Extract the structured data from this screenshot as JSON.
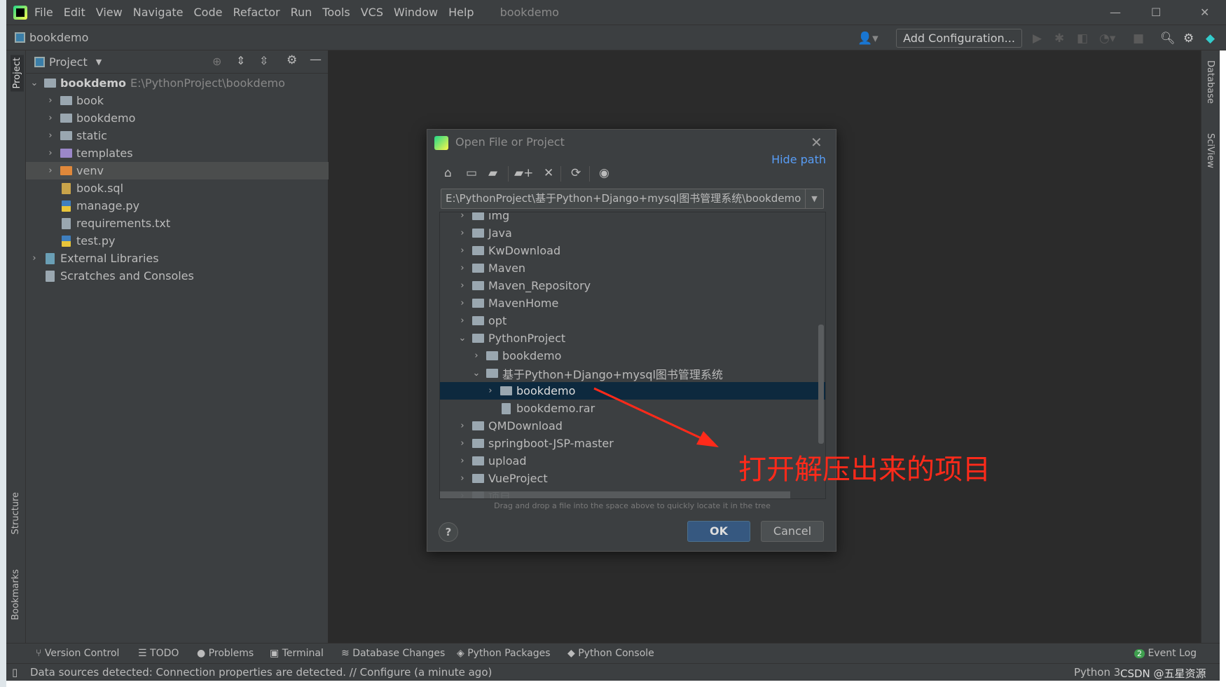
{
  "menubar": {
    "items": [
      "File",
      "Edit",
      "View",
      "Navigate",
      "Code",
      "Refactor",
      "Run",
      "Tools",
      "VCS",
      "Window",
      "Help"
    ],
    "window_title": "bookdemo"
  },
  "navbar": {
    "project": "bookdemo",
    "add_configuration": "Add Configuration..."
  },
  "left_stripe": {
    "project": "Project",
    "structure": "Structure",
    "bookmarks": "Bookmarks"
  },
  "right_stripe": {
    "database": "Database",
    "sciview": "SciView"
  },
  "project_panel": {
    "title": "Project",
    "root": {
      "name": "bookdemo",
      "path": "E:\\PythonProject\\bookdemo"
    },
    "items": [
      {
        "name": "book",
        "type": "folder",
        "indent": 1,
        "expandable": true
      },
      {
        "name": "bookdemo",
        "type": "folder",
        "indent": 1,
        "expandable": true
      },
      {
        "name": "static",
        "type": "folder",
        "indent": 1,
        "expandable": true
      },
      {
        "name": "templates",
        "type": "folder-purple",
        "indent": 1,
        "expandable": true
      },
      {
        "name": "venv",
        "type": "folder-orange",
        "indent": 1,
        "expandable": true,
        "selected": true
      },
      {
        "name": "book.sql",
        "type": "sql",
        "indent": 1
      },
      {
        "name": "manage.py",
        "type": "python",
        "indent": 1
      },
      {
        "name": "requirements.txt",
        "type": "text",
        "indent": 1
      },
      {
        "name": "test.py",
        "type": "python",
        "indent": 1
      },
      {
        "name": "External Libraries",
        "type": "library",
        "indent": 0,
        "expandable": true
      },
      {
        "name": "Scratches and Consoles",
        "type": "scratch",
        "indent": 0
      }
    ]
  },
  "dialog": {
    "title": "Open File or Project",
    "hide_path": "Hide path",
    "path": "E:\\PythonProject\\基于Python+Django+mysql图书管理系统\\bookdemo",
    "tree": [
      {
        "name": "img",
        "indent": 0,
        "expanded": false
      },
      {
        "name": "Java",
        "indent": 0,
        "expanded": false
      },
      {
        "name": "KwDownload",
        "indent": 0,
        "expanded": false
      },
      {
        "name": "Maven",
        "indent": 0,
        "expanded": false
      },
      {
        "name": "Maven_Repository",
        "indent": 0,
        "expanded": false
      },
      {
        "name": "MavenHome",
        "indent": 0,
        "expanded": false
      },
      {
        "name": "opt",
        "indent": 0,
        "expanded": false
      },
      {
        "name": "PythonProject",
        "indent": 0,
        "expanded": true
      },
      {
        "name": "bookdemo",
        "indent": 1,
        "expanded": false
      },
      {
        "name": "基于Python+Django+mysql图书管理系统",
        "indent": 1,
        "expanded": true
      },
      {
        "name": "bookdemo",
        "indent": 2,
        "expanded": false,
        "selected": true
      },
      {
        "name": "bookdemo.rar",
        "indent": 2,
        "file": true
      },
      {
        "name": "QMDownload",
        "indent": 0,
        "expanded": false
      },
      {
        "name": "springboot-JSP-master",
        "indent": 0,
        "expanded": false
      },
      {
        "name": "upload",
        "indent": 0,
        "expanded": false
      },
      {
        "name": "VueProject",
        "indent": 0,
        "expanded": false
      },
      {
        "name": "项目",
        "indent": 0,
        "expanded": false
      }
    ],
    "hint": "Drag and drop a file into the space above to quickly locate it in the tree",
    "ok": "OK",
    "cancel": "Cancel",
    "help": "?"
  },
  "annotation": {
    "text": "打开解压出来的项目",
    "color": "#ff2a1a"
  },
  "bottom_tools": [
    "Version Control",
    "TODO",
    "Problems",
    "Terminal",
    "Database Changes",
    "Python Packages",
    "Python Console"
  ],
  "event_log": {
    "label": "Event Log",
    "count": "2"
  },
  "status": {
    "message": "Data sources detected: Connection properties are detected. // Configure (a minute ago)",
    "right": "Python 3",
    "watermark": "CSDN @五星资源"
  }
}
